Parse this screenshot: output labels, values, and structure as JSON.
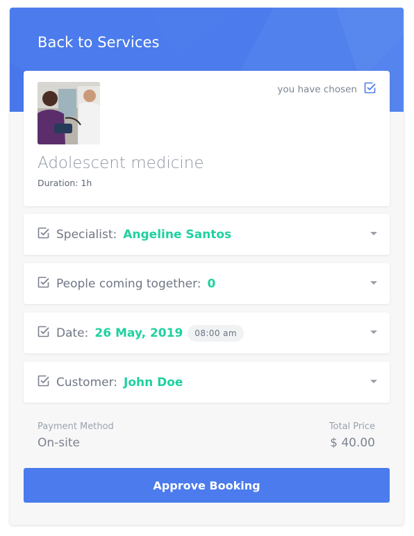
{
  "header": {
    "back_label": "Back to Services"
  },
  "service": {
    "chosen_label": "you have chosen",
    "name": "Adolescent medicine",
    "duration": "Duration: 1h"
  },
  "rows": {
    "specialist": {
      "label": "Specialist:",
      "value": "Angeline Santos"
    },
    "people": {
      "label": "People coming together:",
      "value": "0"
    },
    "date": {
      "label": "Date:",
      "value": "26 May, 2019",
      "time": "08:00 am"
    },
    "customer": {
      "label": "Customer:",
      "value": "John Doe"
    }
  },
  "footer": {
    "payment_label": "Payment Method",
    "payment_value": "On-site",
    "price_label": "Total Price",
    "price_value": "$ 40.00"
  },
  "actions": {
    "approve_label": "Approve Booking"
  },
  "colors": {
    "accent": "#4b7bec",
    "value": "#1fd1a0",
    "text": "#6f7684"
  },
  "icons": [
    "checkbox-checked-icon",
    "chevron-down-icon"
  ]
}
